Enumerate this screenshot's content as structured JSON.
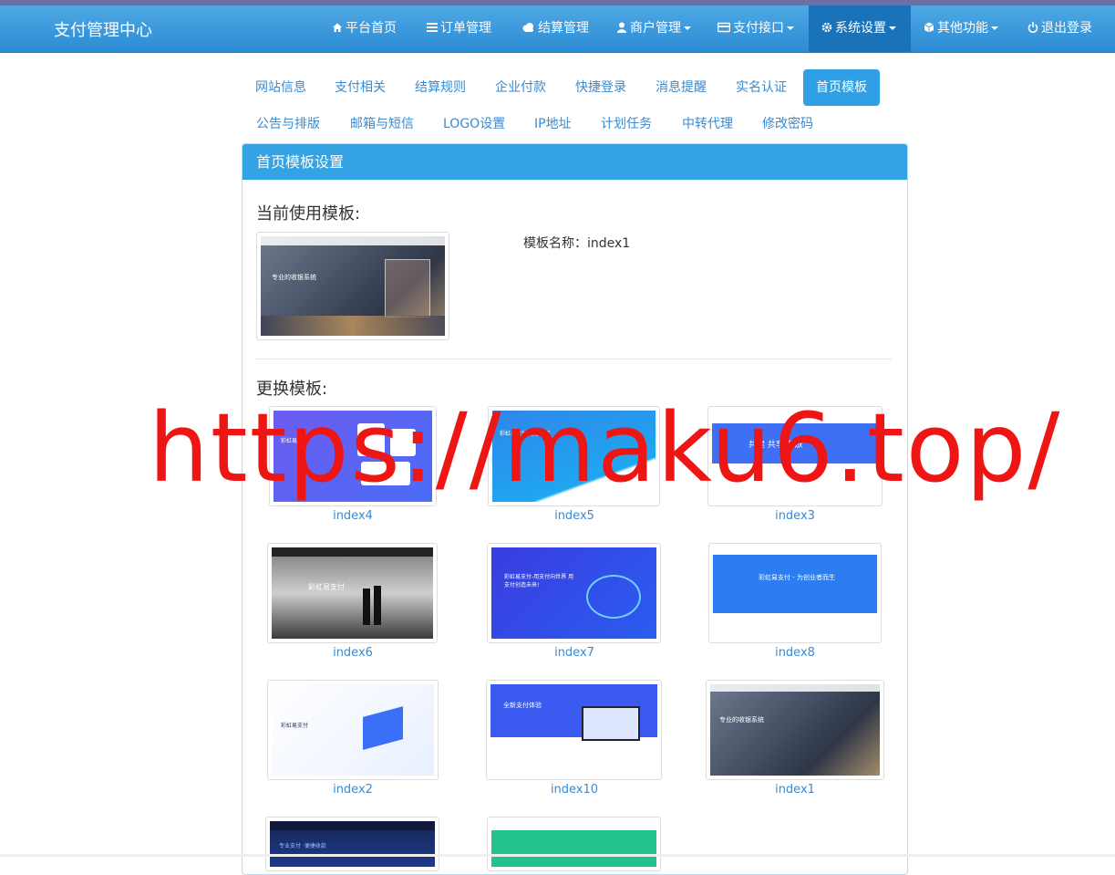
{
  "brand": "支付管理中心",
  "nav": [
    {
      "label": "平台首页",
      "icon": "home-icon"
    },
    {
      "label": "订单管理",
      "icon": "list-icon"
    },
    {
      "label": "结算管理",
      "icon": "cloud-icon"
    },
    {
      "label": "商户管理",
      "icon": "user-icon"
    },
    {
      "label": "支付接口",
      "icon": "credit-card-icon"
    },
    {
      "label": "系统设置",
      "icon": "gear-icon"
    },
    {
      "label": "其他功能",
      "icon": "cube-icon"
    },
    {
      "label": "退出登录",
      "icon": "power-icon"
    }
  ],
  "tabs_row1": [
    "网站信息",
    "支付相关",
    "结算规则",
    "企业付款",
    "快捷登录",
    "消息提醒",
    "实名认证",
    "首页模板"
  ],
  "tabs_row2": [
    "公告与排版",
    "邮箱与短信",
    "LOGO设置",
    "IP地址",
    "计划任务",
    "中转代理",
    "修改密码"
  ],
  "panel": {
    "title": "首页模板设置",
    "current_label": "当前使用模板:",
    "template_name_label": "模板名称：index1",
    "change_label": "更换模板:"
  },
  "current_preview_text": "专业的收银系统",
  "templates": [
    {
      "name": "index4",
      "caption": "彩虹易支付"
    },
    {
      "name": "index5",
      "caption": "彩虹易支付 为您服务"
    },
    {
      "name": "index3",
      "caption": "共建 共享 开放"
    },
    {
      "name": "index6",
      "caption": "彩虹易支付"
    },
    {
      "name": "index7",
      "caption": "彩虹易支付-用支付向世界 用支付创造未来!"
    },
    {
      "name": "index8",
      "caption": "彩虹易支付 - 为创业者而生"
    },
    {
      "name": "index2",
      "caption": "彩虹易支付"
    },
    {
      "name": "index10",
      "caption": "全新支付体验"
    },
    {
      "name": "index1",
      "caption": "专业的收银系统"
    },
    {
      "name": "",
      "caption": "专业支付 ·便捷收款"
    },
    {
      "name": "",
      "caption": ""
    }
  ],
  "watermark": "https://maku6.top/",
  "colors": {
    "primary": "#33a3e3",
    "link": "#3a8ad0",
    "watermark": "#ee1515"
  }
}
